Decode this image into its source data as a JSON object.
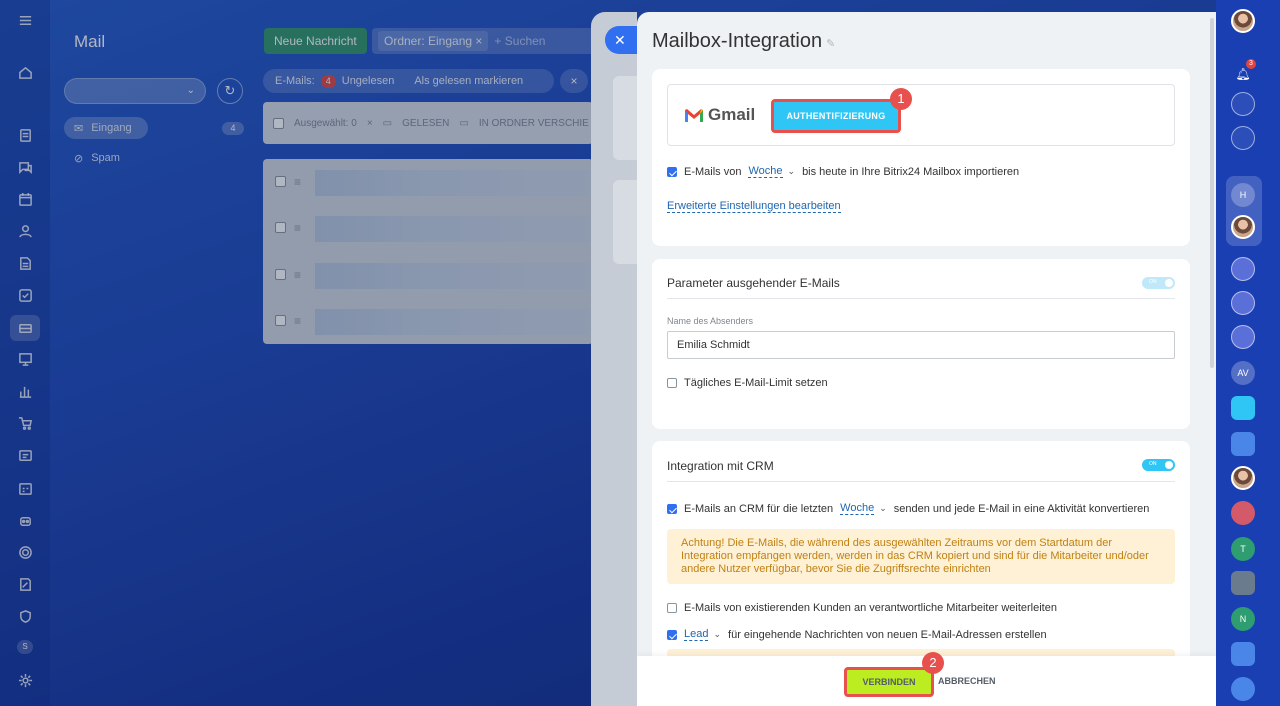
{
  "mail": {
    "title": "Mail",
    "new_message": "Neue Nachricht",
    "filter_tag": "Ordner: Eingang",
    "filter_tag_close": "×",
    "search_placeholder": "+ Suchen",
    "counter_label": "E-Mails:",
    "counter_value": "4",
    "counter_unread": "Ungelesen",
    "mark_read": "Als gelesen markieren",
    "selected": "Ausgewählt: 0",
    "action_read": "GELESEN",
    "action_move": "IN ORDNER VERSCHIE",
    "folders": [
      {
        "label": "Eingang",
        "count": "4",
        "icon": "inbox-icon"
      },
      {
        "label": "Spam",
        "icon": "spam-icon"
      }
    ]
  },
  "slider": {
    "title": "Mailbox-Integration",
    "gmail_label": "Gmail",
    "auth_button": "AUTHENTIFIZIERUNG",
    "step1": "1",
    "step2": "2",
    "import_prefix": "E-Mails von",
    "import_period": "Woche",
    "import_suffix": "bis heute in Ihre Bitrix24 Mailbox importieren",
    "advanced_link": "Erweiterte Einstellungen bearbeiten",
    "outgoing": {
      "title": "Parameter ausgehender E-Mails",
      "toggle": "ON",
      "sender_label": "Name des Absenders",
      "sender_value": "Emilia Schmidt",
      "limit_label": "Tägliches E-Mail-Limit setzen"
    },
    "crm": {
      "title": "Integration mit CRM",
      "toggle": "ON",
      "crm_prefix": "E-Mails an CRM für die letzten",
      "crm_period": "Woche",
      "crm_suffix": "senden und jede E-Mail in eine Aktivität konvertieren",
      "warning": "Achtung! Die E-Mails, die während des ausgewählten Zeitraums vor dem Startdatum der Integration empfangen werden, werden in das CRM kopiert und sind für die Mitarbeiter und/oder andere Nutzer verfügbar, bevor Sie die Zugriffsrechte einrichten",
      "forward_label": "E-Mails von existierenden Kunden an verantwortliche Mitarbeiter weiterleiten",
      "lead_value": "Lead",
      "lead_suffix": "für eingehende Nachrichten von neuen E-Mail-Adressen erstellen"
    },
    "connect_button": "VERBINDEN",
    "cancel_button": "ABBRECHEN"
  },
  "rightbar": {
    "notification_count": "3",
    "letters": [
      "H",
      "AV",
      "T",
      "N"
    ]
  },
  "leftnav": {
    "badge": "S"
  },
  "colors": {
    "accent": "#2fc6f6",
    "highlight": "#e8504e",
    "connect": "#bbed21",
    "link": "#2067b0"
  }
}
